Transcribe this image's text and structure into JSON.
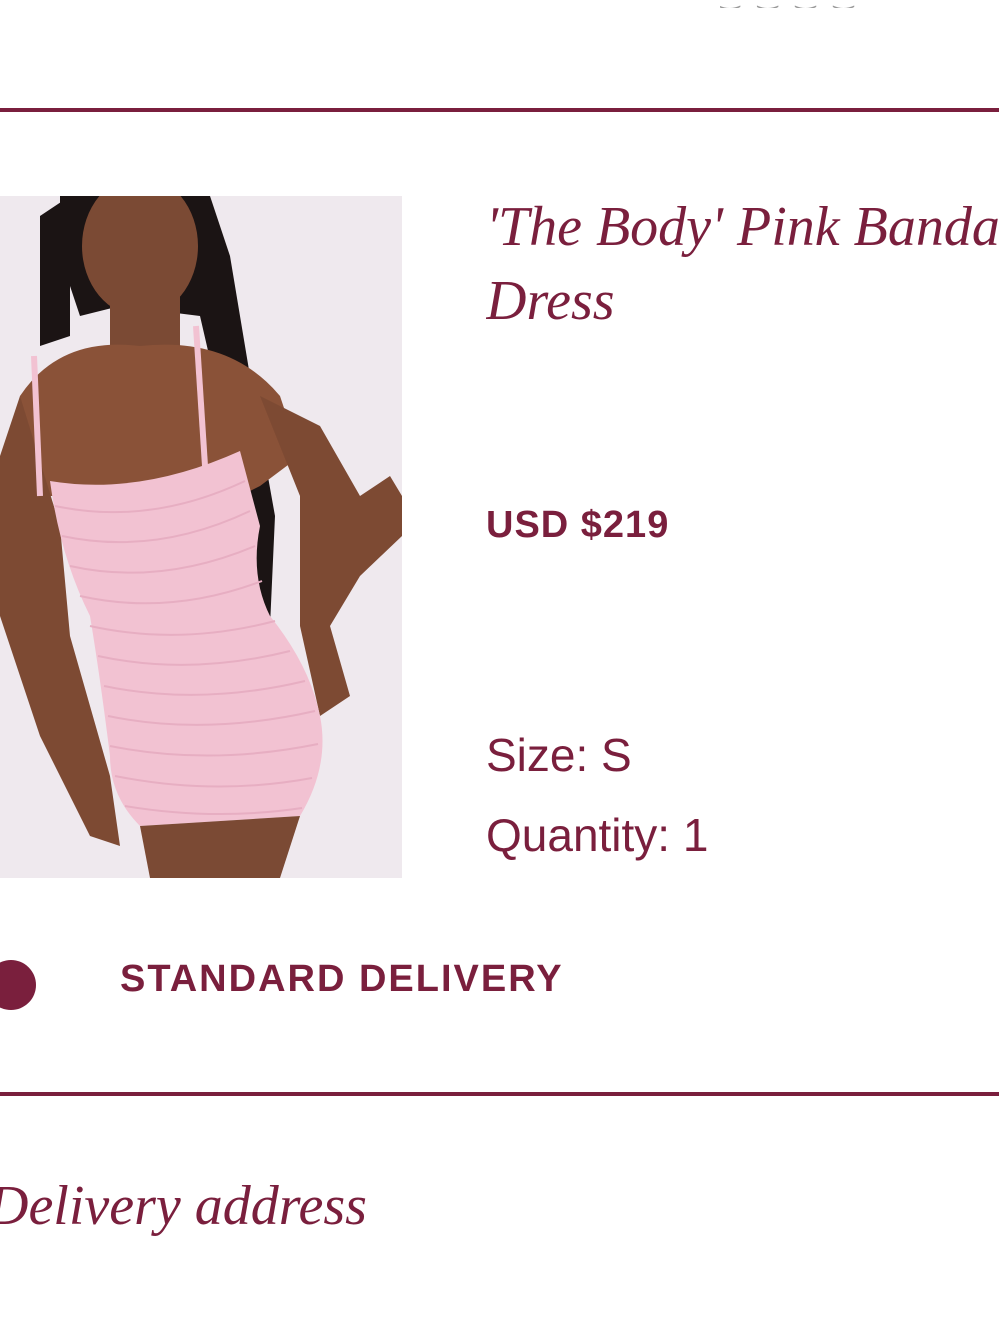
{
  "order": {
    "product": {
      "title": "'The Body' Pink Bandage Dress",
      "price": "USD $219",
      "size": "Size: S",
      "quantity": "Quantity: 1",
      "image_icon": "product-photo"
    },
    "delivery": {
      "option_label": "STANDARD DELIVERY",
      "selected": true
    },
    "address": {
      "heading": "Delivery address"
    }
  },
  "colors": {
    "accent": "#7a1f3d",
    "dress": "#f2c2d2",
    "image_bg": "#efe9ee"
  }
}
